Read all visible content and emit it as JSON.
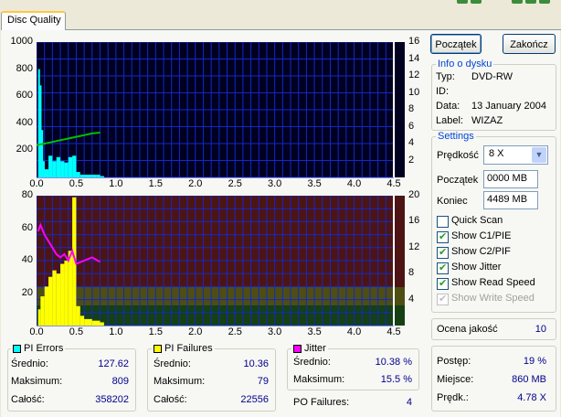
{
  "tab": {
    "label": "Disc Quality"
  },
  "chart_data": [
    {
      "type": "bar",
      "title": "",
      "ylim_left": [
        0,
        1000
      ],
      "ylim_right": [
        0,
        16
      ],
      "xlim": [
        0,
        4.5
      ],
      "y_ticks_left": [
        "1000",
        "800",
        "600",
        "400",
        "200"
      ],
      "y_ticks_right": [
        "16",
        "14",
        "12",
        "10",
        "8",
        "6",
        "4",
        "2"
      ],
      "x_ticks": [
        "0.0",
        "0.5",
        "1.0",
        "1.5",
        "2.0",
        "2.5",
        "3.0",
        "3.5",
        "4.0",
        "4.5"
      ],
      "series": [
        {
          "name": "PI Errors",
          "color": "#00ffff",
          "x": [
            0.02,
            0.04,
            0.06,
            0.08,
            0.1,
            0.15,
            0.2,
            0.25,
            0.3,
            0.35,
            0.4,
            0.45,
            0.5,
            0.55,
            0.6,
            0.65,
            0.7,
            0.75,
            0.8
          ],
          "values": [
            800,
            680,
            350,
            120,
            60,
            160,
            120,
            150,
            120,
            110,
            150,
            160,
            40,
            20,
            20,
            20,
            20,
            20,
            10
          ]
        },
        {
          "name": "Read Speed",
          "color": "#00c000",
          "x": [
            0.0,
            0.1,
            0.2,
            0.3,
            0.4,
            0.5,
            0.6,
            0.7,
            0.8
          ],
          "values": [
            3.8,
            4.0,
            4.2,
            4.4,
            4.6,
            4.8,
            5.0,
            5.2,
            5.3
          ]
        }
      ]
    },
    {
      "type": "bar",
      "title": "",
      "ylim_left": [
        0,
        80
      ],
      "ylim_right": [
        0,
        20
      ],
      "xlim": [
        0,
        4.5
      ],
      "y_ticks_left": [
        "80",
        "60",
        "40",
        "20"
      ],
      "y_ticks_right": [
        "20",
        "16",
        "12",
        "8",
        "4"
      ],
      "x_ticks": [
        "0.0",
        "0.5",
        "1.0",
        "1.5",
        "2.0",
        "2.5",
        "3.0",
        "3.5",
        "4.0",
        "4.5"
      ],
      "series": [
        {
          "name": "PI Failures",
          "color": "#ffff00",
          "x": [
            0.02,
            0.05,
            0.1,
            0.15,
            0.2,
            0.25,
            0.3,
            0.35,
            0.4,
            0.45,
            0.5,
            0.55,
            0.6,
            0.7,
            0.8
          ],
          "values": [
            10,
            18,
            24,
            30,
            34,
            32,
            38,
            40,
            46,
            79,
            12,
            6,
            4,
            3,
            2
          ]
        },
        {
          "name": "Jitter",
          "color": "#ff00ff",
          "x": [
            0.02,
            0.05,
            0.1,
            0.15,
            0.2,
            0.25,
            0.3,
            0.35,
            0.4,
            0.45,
            0.5,
            0.6,
            0.7,
            0.8
          ],
          "values": [
            14.5,
            15.5,
            14.0,
            13.0,
            12.0,
            11.0,
            10.5,
            11.0,
            10.0,
            11.5,
            9.5,
            10.0,
            10.5,
            9.8
          ]
        }
      ]
    }
  ],
  "buttons": {
    "start": "Początek",
    "end": "Zakończ"
  },
  "disc_info": {
    "title": "Info o dysku",
    "type_label": "Typ:",
    "type_value": "DVD-RW",
    "id_label": "ID:",
    "id_value": "",
    "date_label": "Data:",
    "date_value": "13 January 2004",
    "label_label": "Label:",
    "label_value": "WIZAZ"
  },
  "settings": {
    "title": "Settings",
    "speed_label": "Prędkość",
    "speed_value": "8 X",
    "start_label": "Początek",
    "start_value": "0000 MB",
    "end_label": "Koniec",
    "end_value": "4489 MB",
    "checkboxes": [
      {
        "label": "Quick Scan",
        "checked": false,
        "disabled": false
      },
      {
        "label": "Show C1/PIE",
        "checked": true,
        "disabled": false
      },
      {
        "label": "Show C2/PIF",
        "checked": true,
        "disabled": false
      },
      {
        "label": "Show Jitter",
        "checked": true,
        "disabled": false
      },
      {
        "label": "Show Read Speed",
        "checked": true,
        "disabled": false
      },
      {
        "label": "Show Write Speed",
        "checked": true,
        "disabled": true
      }
    ]
  },
  "quality": {
    "label": "Ocena jakość",
    "value": "10"
  },
  "pi_errors": {
    "title": "PI Errors",
    "color": "#00ffff",
    "avg_label": "Średnio:",
    "avg": "127.62",
    "max_label": "Maksimum:",
    "max": "809",
    "total_label": "Całość:",
    "total": "358202"
  },
  "pi_failures": {
    "title": "PI Failures",
    "color": "#ffff00",
    "avg_label": "Średnio:",
    "avg": "10.36",
    "max_label": "Maksimum:",
    "max": "79",
    "total_label": "Całość:",
    "total": "22556"
  },
  "jitter": {
    "title": "Jitter",
    "color": "#ff00ff",
    "avg_label": "Średnio:",
    "avg": "10.38 %",
    "max_label": "Maksimum:",
    "max": "15.5 %"
  },
  "po_failures": {
    "label": "PO Failures:",
    "value": "4"
  },
  "progress": {
    "progress_label": "Postęp:",
    "progress_value": "19 %",
    "position_label": "Miejsce:",
    "position_value": "860 MB",
    "speed_label": "Prędk.:",
    "speed_value": "4.78 X"
  }
}
